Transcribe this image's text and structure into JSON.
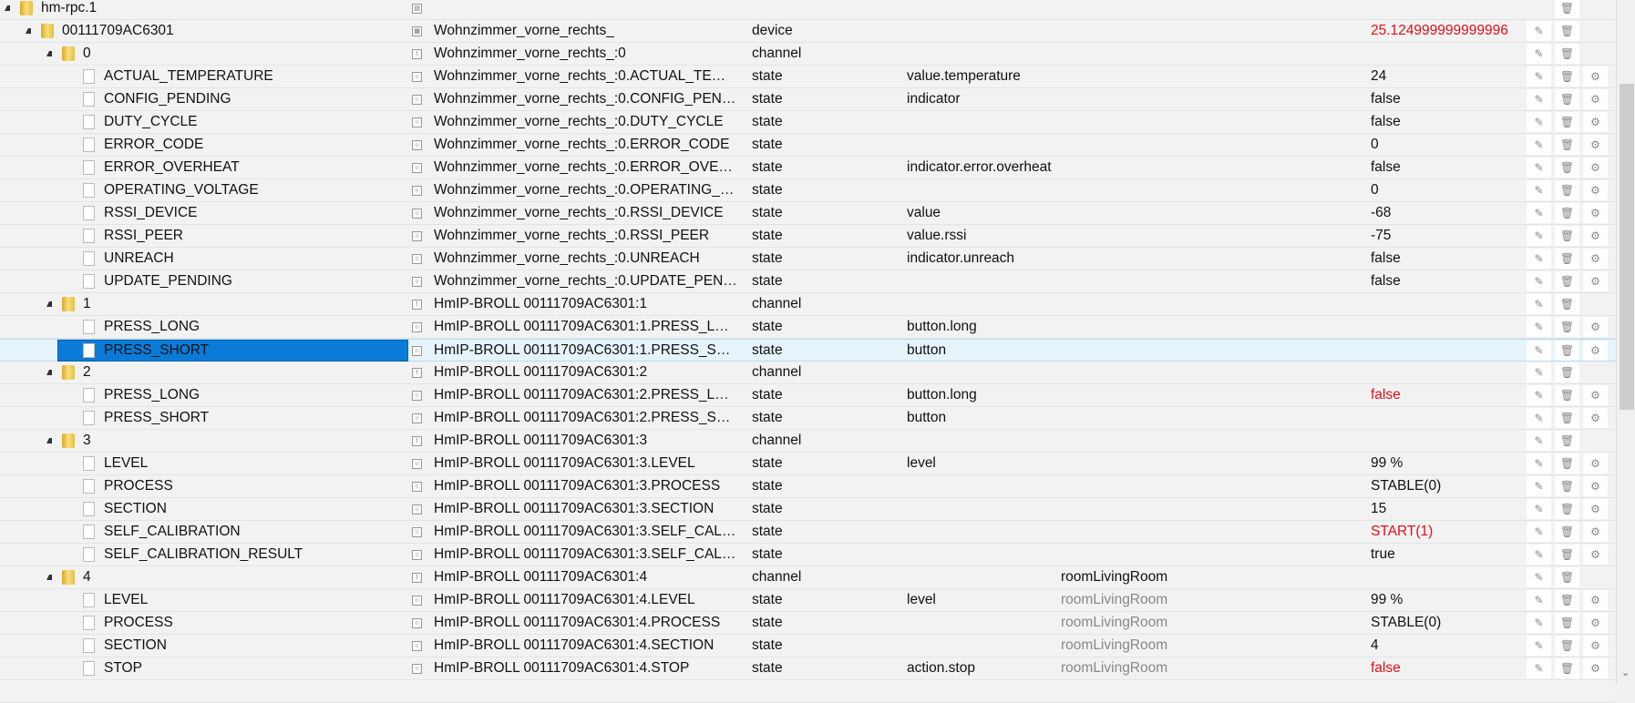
{
  "rows": [
    {
      "level": 0,
      "folder": true,
      "name": "hm-rpc.1",
      "icon": "instance-icon",
      "obj": "",
      "type": "",
      "role": "",
      "room": "",
      "value": "",
      "btns": "d"
    },
    {
      "level": 1,
      "folder": true,
      "name": "00111709AC6301",
      "icon": "device-icon",
      "obj": "Wohnzimmer_vorne_rechts_",
      "type": "device",
      "role": "",
      "room": "",
      "value": "25.124999999999996",
      "red": true,
      "btns": "ed"
    },
    {
      "level": 2,
      "folder": true,
      "name": "0",
      "icon": "channel-icon",
      "obj": "Wohnzimmer_vorne_rechts_:0",
      "type": "channel",
      "role": "",
      "room": "",
      "value": "",
      "btns": "ed"
    },
    {
      "level": 3,
      "name": "ACTUAL_TEMPERATURE",
      "icon": "state-icon",
      "obj": "Wohnzimmer_vorne_rechts_:0.ACTUAL_TE…",
      "type": "state",
      "role": "value.temperature",
      "room": "",
      "value": "24",
      "btns": "edg"
    },
    {
      "level": 3,
      "name": "CONFIG_PENDING",
      "icon": "state-icon",
      "obj": "Wohnzimmer_vorne_rechts_:0.CONFIG_PEN…",
      "type": "state",
      "role": "indicator",
      "room": "",
      "value": "false",
      "btns": "edg"
    },
    {
      "level": 3,
      "name": "DUTY_CYCLE",
      "icon": "state-icon",
      "obj": "Wohnzimmer_vorne_rechts_:0.DUTY_CYCLE",
      "type": "state",
      "role": "",
      "room": "",
      "value": "false",
      "btns": "edg"
    },
    {
      "level": 3,
      "name": "ERROR_CODE",
      "icon": "state-icon",
      "obj": "Wohnzimmer_vorne_rechts_:0.ERROR_CODE",
      "type": "state",
      "role": "",
      "room": "",
      "value": "0",
      "btns": "edg"
    },
    {
      "level": 3,
      "name": "ERROR_OVERHEAT",
      "icon": "state-icon",
      "obj": "Wohnzimmer_vorne_rechts_:0.ERROR_OVE…",
      "type": "state",
      "role": "indicator.error.overheat",
      "room": "",
      "value": "false",
      "btns": "edg"
    },
    {
      "level": 3,
      "name": "OPERATING_VOLTAGE",
      "icon": "state-icon",
      "obj": "Wohnzimmer_vorne_rechts_:0.OPERATING_…",
      "type": "state",
      "role": "",
      "room": "",
      "value": "0",
      "btns": "edg"
    },
    {
      "level": 3,
      "name": "RSSI_DEVICE",
      "icon": "state-icon",
      "obj": "Wohnzimmer_vorne_rechts_:0.RSSI_DEVICE",
      "type": "state",
      "role": "value",
      "room": "",
      "value": "-68",
      "btns": "edg"
    },
    {
      "level": 3,
      "name": "RSSI_PEER",
      "icon": "state-icon",
      "obj": "Wohnzimmer_vorne_rechts_:0.RSSI_PEER",
      "type": "state",
      "role": "value.rssi",
      "room": "",
      "value": "-75",
      "btns": "edg"
    },
    {
      "level": 3,
      "name": "UNREACH",
      "icon": "state-icon",
      "obj": "Wohnzimmer_vorne_rechts_:0.UNREACH",
      "type": "state",
      "role": "indicator.unreach",
      "room": "",
      "value": "false",
      "btns": "edg"
    },
    {
      "level": 3,
      "name": "UPDATE_PENDING",
      "icon": "state-icon",
      "obj": "Wohnzimmer_vorne_rechts_:0.UPDATE_PEN…",
      "type": "state",
      "role": "",
      "room": "",
      "value": "false",
      "btns": "edg"
    },
    {
      "level": 2,
      "folder": true,
      "name": "1",
      "icon": "channel-icon",
      "obj": "HmIP-BROLL 00111709AC6301:1",
      "type": "channel",
      "role": "",
      "room": "",
      "value": "",
      "btns": "ed"
    },
    {
      "level": 3,
      "name": "PRESS_LONG",
      "icon": "state-icon",
      "obj": "HmIP-BROLL 00111709AC6301:1.PRESS_L…",
      "type": "state",
      "role": "button.long",
      "room": "",
      "value": "",
      "btns": "edg"
    },
    {
      "level": 3,
      "name": "PRESS_SHORT",
      "icon": "state-icon",
      "obj": "HmIP-BROLL 00111709AC6301:1.PRESS_S…",
      "type": "state",
      "role": "button",
      "room": "",
      "value": "",
      "btns": "edg",
      "selected": true
    },
    {
      "level": 2,
      "folder": true,
      "name": "2",
      "icon": "channel-icon",
      "obj": "HmIP-BROLL 00111709AC6301:2",
      "type": "channel",
      "role": "",
      "room": "",
      "value": "",
      "btns": "ed"
    },
    {
      "level": 3,
      "name": "PRESS_LONG",
      "icon": "state-icon",
      "obj": "HmIP-BROLL 00111709AC6301:2.PRESS_L…",
      "type": "state",
      "role": "button.long",
      "room": "",
      "value": "false",
      "red": true,
      "btns": "edg"
    },
    {
      "level": 3,
      "name": "PRESS_SHORT",
      "icon": "state-icon",
      "obj": "HmIP-BROLL 00111709AC6301:2.PRESS_S…",
      "type": "state",
      "role": "button",
      "room": "",
      "value": "",
      "btns": "edg"
    },
    {
      "level": 2,
      "folder": true,
      "name": "3",
      "icon": "channel-icon",
      "obj": "HmIP-BROLL 00111709AC6301:3",
      "type": "channel",
      "role": "",
      "room": "",
      "value": "",
      "btns": "ed"
    },
    {
      "level": 3,
      "name": "LEVEL",
      "icon": "state-icon",
      "obj": "HmIP-BROLL 00111709AC6301:3.LEVEL",
      "type": "state",
      "role": "level",
      "room": "",
      "value": "99 %",
      "btns": "edg"
    },
    {
      "level": 3,
      "name": "PROCESS",
      "icon": "state-icon",
      "obj": "HmIP-BROLL 00111709AC6301:3.PROCESS",
      "type": "state",
      "role": "",
      "room": "",
      "value": "STABLE(0)",
      "btns": "edg"
    },
    {
      "level": 3,
      "name": "SECTION",
      "icon": "state-icon",
      "obj": "HmIP-BROLL 00111709AC6301:3.SECTION",
      "type": "state",
      "role": "",
      "room": "",
      "value": "15",
      "btns": "edg"
    },
    {
      "level": 3,
      "name": "SELF_CALIBRATION",
      "icon": "state-icon",
      "obj": "HmIP-BROLL 00111709AC6301:3.SELF_CAL…",
      "type": "state",
      "role": "",
      "room": "",
      "value": "START(1)",
      "red": true,
      "btns": "edg"
    },
    {
      "level": 3,
      "name": "SELF_CALIBRATION_RESULT",
      "icon": "state-icon",
      "obj": "HmIP-BROLL 00111709AC6301:3.SELF_CAL…",
      "type": "state",
      "role": "",
      "room": "",
      "value": "true",
      "btns": "edg"
    },
    {
      "level": 2,
      "folder": true,
      "name": "4",
      "icon": "channel-icon",
      "obj": "HmIP-BROLL 00111709AC6301:4",
      "type": "channel",
      "role": "",
      "room": "roomLivingRoom",
      "value": "",
      "btns": "ed"
    },
    {
      "level": 3,
      "name": "LEVEL",
      "icon": "state-icon",
      "obj": "HmIP-BROLL 00111709AC6301:4.LEVEL",
      "type": "state",
      "role": "level",
      "room": "roomLivingRoom",
      "roomGray": true,
      "value": "99 %",
      "btns": "edg"
    },
    {
      "level": 3,
      "name": "PROCESS",
      "icon": "state-icon",
      "obj": "HmIP-BROLL 00111709AC6301:4.PROCESS",
      "type": "state",
      "role": "",
      "room": "roomLivingRoom",
      "roomGray": true,
      "value": "STABLE(0)",
      "btns": "edg"
    },
    {
      "level": 3,
      "name": "SECTION",
      "icon": "state-icon",
      "obj": "HmIP-BROLL 00111709AC6301:4.SECTION",
      "type": "state",
      "role": "",
      "room": "roomLivingRoom",
      "roomGray": true,
      "value": "4",
      "btns": "edg"
    },
    {
      "level": 3,
      "name": "STOP",
      "icon": "state-icon",
      "obj": "HmIP-BROLL 00111709AC6301:4.STOP",
      "type": "state",
      "role": "action.stop",
      "room": "roomLivingRoom",
      "roomGray": true,
      "value": "false",
      "red": true,
      "btns": "edg"
    }
  ],
  "colors": {
    "value_red": "#e0101a",
    "selection": "#0a7bd8"
  }
}
